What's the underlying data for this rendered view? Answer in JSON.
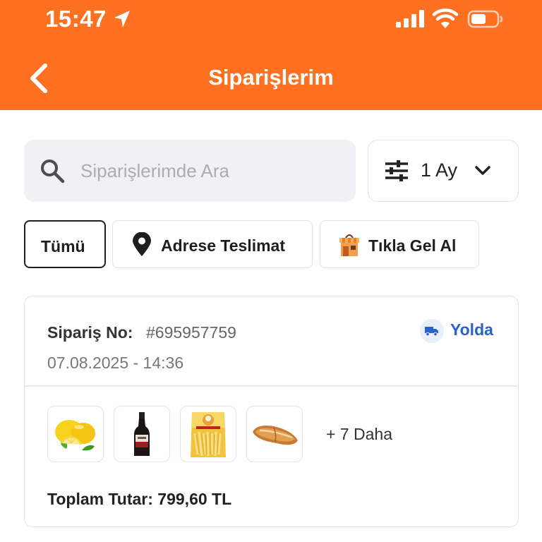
{
  "status_bar": {
    "time": "15:47",
    "icons": [
      "location-arrow-icon",
      "cellular-signal-icon",
      "wifi-icon",
      "battery-icon"
    ]
  },
  "header": {
    "title": "Siparişlerim",
    "back_icon": "chevron-left-icon",
    "background_color": "#ff7020"
  },
  "search": {
    "placeholder": "Siparişlerimde Ara",
    "value": ""
  },
  "filter": {
    "selected": "1 Ay"
  },
  "tabs": [
    {
      "label": "Tümü",
      "selected": true
    },
    {
      "label": "Adrese Teslimat",
      "icon": "location-pin-icon"
    },
    {
      "label": "Tıkla Gel Al",
      "icon": "store-icon"
    }
  ],
  "order": {
    "number_label": "Sipariş No:",
    "number": "#695957759",
    "date": "07.08.2025 - 14:36",
    "status": "Yolda",
    "status_color": "#2962c9",
    "products": [
      {
        "icon": "lemon-product-icon"
      },
      {
        "icon": "bottle-product-icon"
      },
      {
        "icon": "pasta-package-product-icon"
      },
      {
        "icon": "bread-product-icon"
      }
    ],
    "more": "+ 7 Daha",
    "total": "Toplam Tutar: 799,60 TL"
  }
}
